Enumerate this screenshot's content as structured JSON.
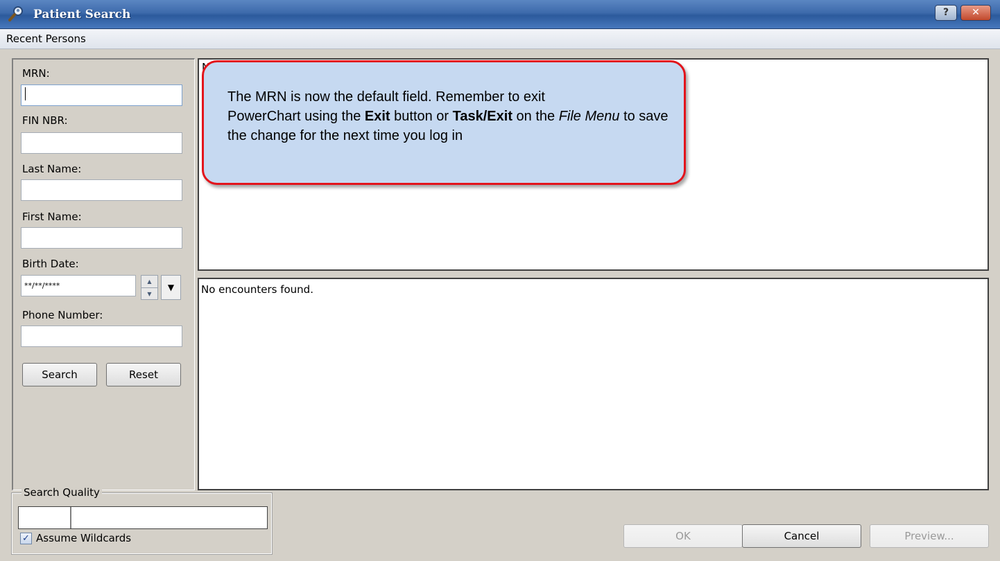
{
  "window": {
    "title": "Patient Search",
    "help_label": "?",
    "close_label": "✕"
  },
  "menubar": {
    "items": [
      {
        "label": "Recent Persons"
      }
    ]
  },
  "form": {
    "mrn_label": "MRN:",
    "mrn_value": "",
    "fin_label": "FIN NBR:",
    "fin_value": "",
    "last_name_label": "Last Name:",
    "last_name_value": "",
    "first_name_label": "First Name:",
    "first_name_value": "",
    "birth_date_label": "Birth Date:",
    "birth_date_value": "**/**/****",
    "phone_label": "Phone Number:",
    "phone_value": "",
    "search_button": "Search",
    "reset_button": "Reset"
  },
  "results": {
    "persons_empty_text": "N",
    "encounters_empty_text": "No encounters found."
  },
  "callout": {
    "line1": "The MRN is now the default field.  Remember to exit",
    "text2": "PowerChart using the ",
    "bold1": "Exit",
    "text3": " button or ",
    "bold2": "Task/Exit",
    "text4": " on the ",
    "italic1": "File Menu",
    "text5": " to save the change for the next time you log in"
  },
  "search_quality": {
    "legend": "Search Quality",
    "level": 0.2,
    "assume_wildcards_label": "Assume Wildcards",
    "assume_wildcards_checked": true
  },
  "footer": {
    "ok_button": "OK",
    "ok_enabled": false,
    "cancel_button": "Cancel",
    "preview_button": "Preview...",
    "preview_enabled": false
  },
  "colors": {
    "title_gradient": "#3d6aab",
    "callout_fill": "#c6d9f1",
    "callout_border": "#e3141b",
    "dialog_bg": "#d4d0c8"
  },
  "icons": [
    "magnifier-person-icon",
    "help-icon",
    "close-icon",
    "spin-up-icon",
    "spin-down-icon",
    "dropdown-arrow-icon",
    "check-icon"
  ]
}
